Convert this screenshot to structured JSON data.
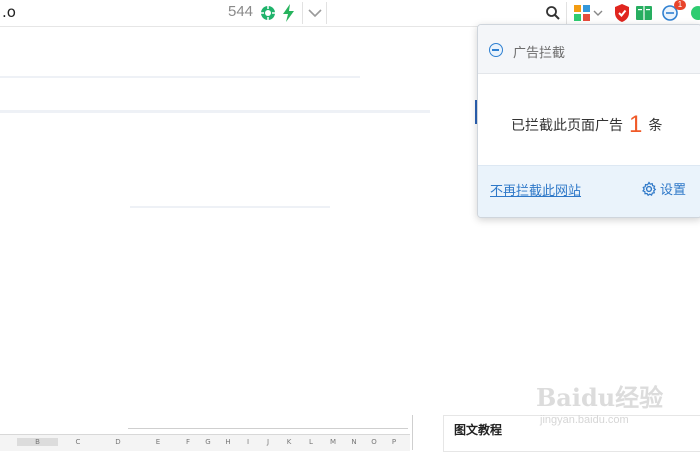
{
  "toolbar": {
    "url_fragment": ".o",
    "counter": "544",
    "extension_badge": "1"
  },
  "popup": {
    "title": "广告拦截",
    "message_prefix": "已拦截此页面广告",
    "count": "1",
    "message_suffix": "条",
    "disable_link": "不再拦截此网站",
    "settings_label": "设置"
  },
  "page": {
    "right_panel_title": "图文教程",
    "sheet_columns": [
      "B",
      "C",
      "D",
      "E",
      "F",
      "G",
      "H",
      "I",
      "J",
      "K",
      "L",
      "M",
      "N",
      "O",
      "P"
    ]
  },
  "watermark": {
    "logo": "Baidu经验",
    "url": "jingyan.baidu.com"
  },
  "colors": {
    "accent": "#2e78c8",
    "count_highlight": "#f05a28",
    "popup_footer_bg": "#eaf3fb"
  }
}
